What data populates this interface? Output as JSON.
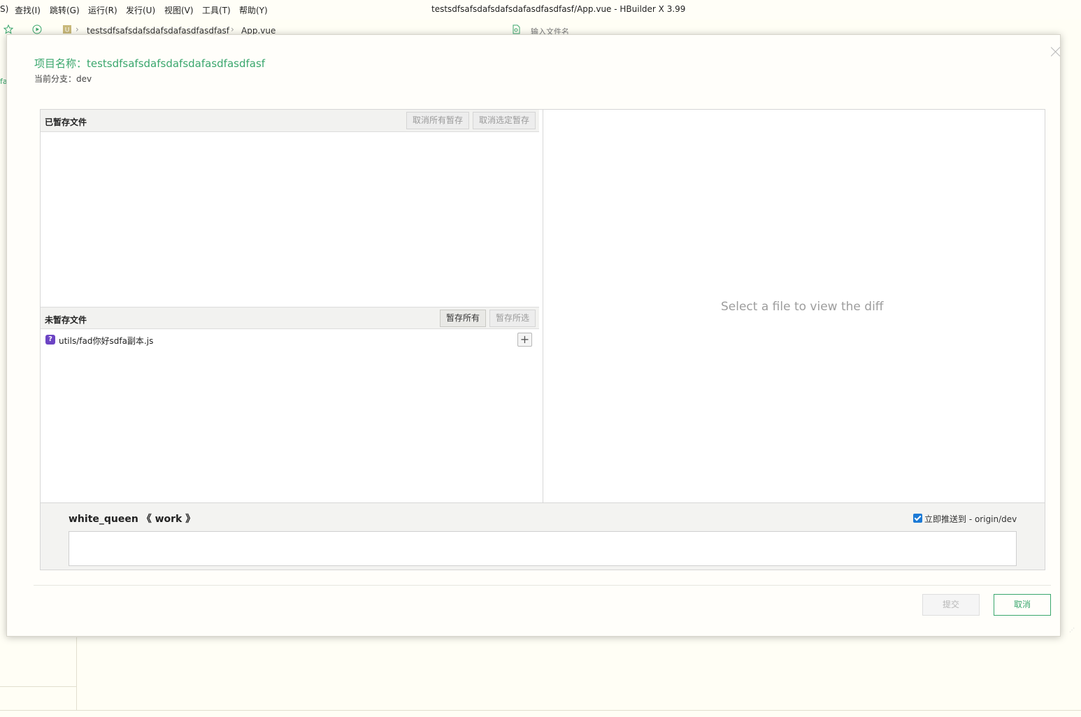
{
  "menu": [
    "S)",
    "查找(I)",
    "跳转(G)",
    "运行(R)",
    "发行(U)",
    "视图(V)",
    "工具(T)",
    "帮助(Y)"
  ],
  "window_title": "testsdfsafsdafsdafsdafasdfasdfasf/App.vue - HBuilder X 3.99",
  "breadcrumb": {
    "project": "testsdfsafsdafsdafsdafasdfasdfasf",
    "file": "App.vue",
    "search_placeholder": "输入文件名"
  },
  "left_hint": "fa",
  "dialog": {
    "project_label": "项目名称：testsdfsafsdafsdafsdafasdfasdfasf",
    "branch_label": "当前分支：dev",
    "staged": {
      "title": "已暂存文件",
      "unstage_all": "取消所有暂存",
      "unstage_selected": "取消选定暂存"
    },
    "unstaged": {
      "title": "未暂存文件",
      "stage_all": "暂存所有",
      "stage_selected": "暂存所选",
      "files": [
        {
          "status_icon": "?",
          "name": "utils/fad你好sdfa副本.js"
        }
      ]
    },
    "diff_placeholder": "Select a file to view the diff",
    "author": "white_queen 《 work 》",
    "push_label": "立即推送到 - origin/dev",
    "push_checked": true,
    "commit_message": "",
    "submit_label": "提交",
    "cancel_label": "取消"
  },
  "colors": {
    "accent": "#3aa76d",
    "checkbox": "#1c7ad6",
    "file_icon": "#6c44c4"
  }
}
